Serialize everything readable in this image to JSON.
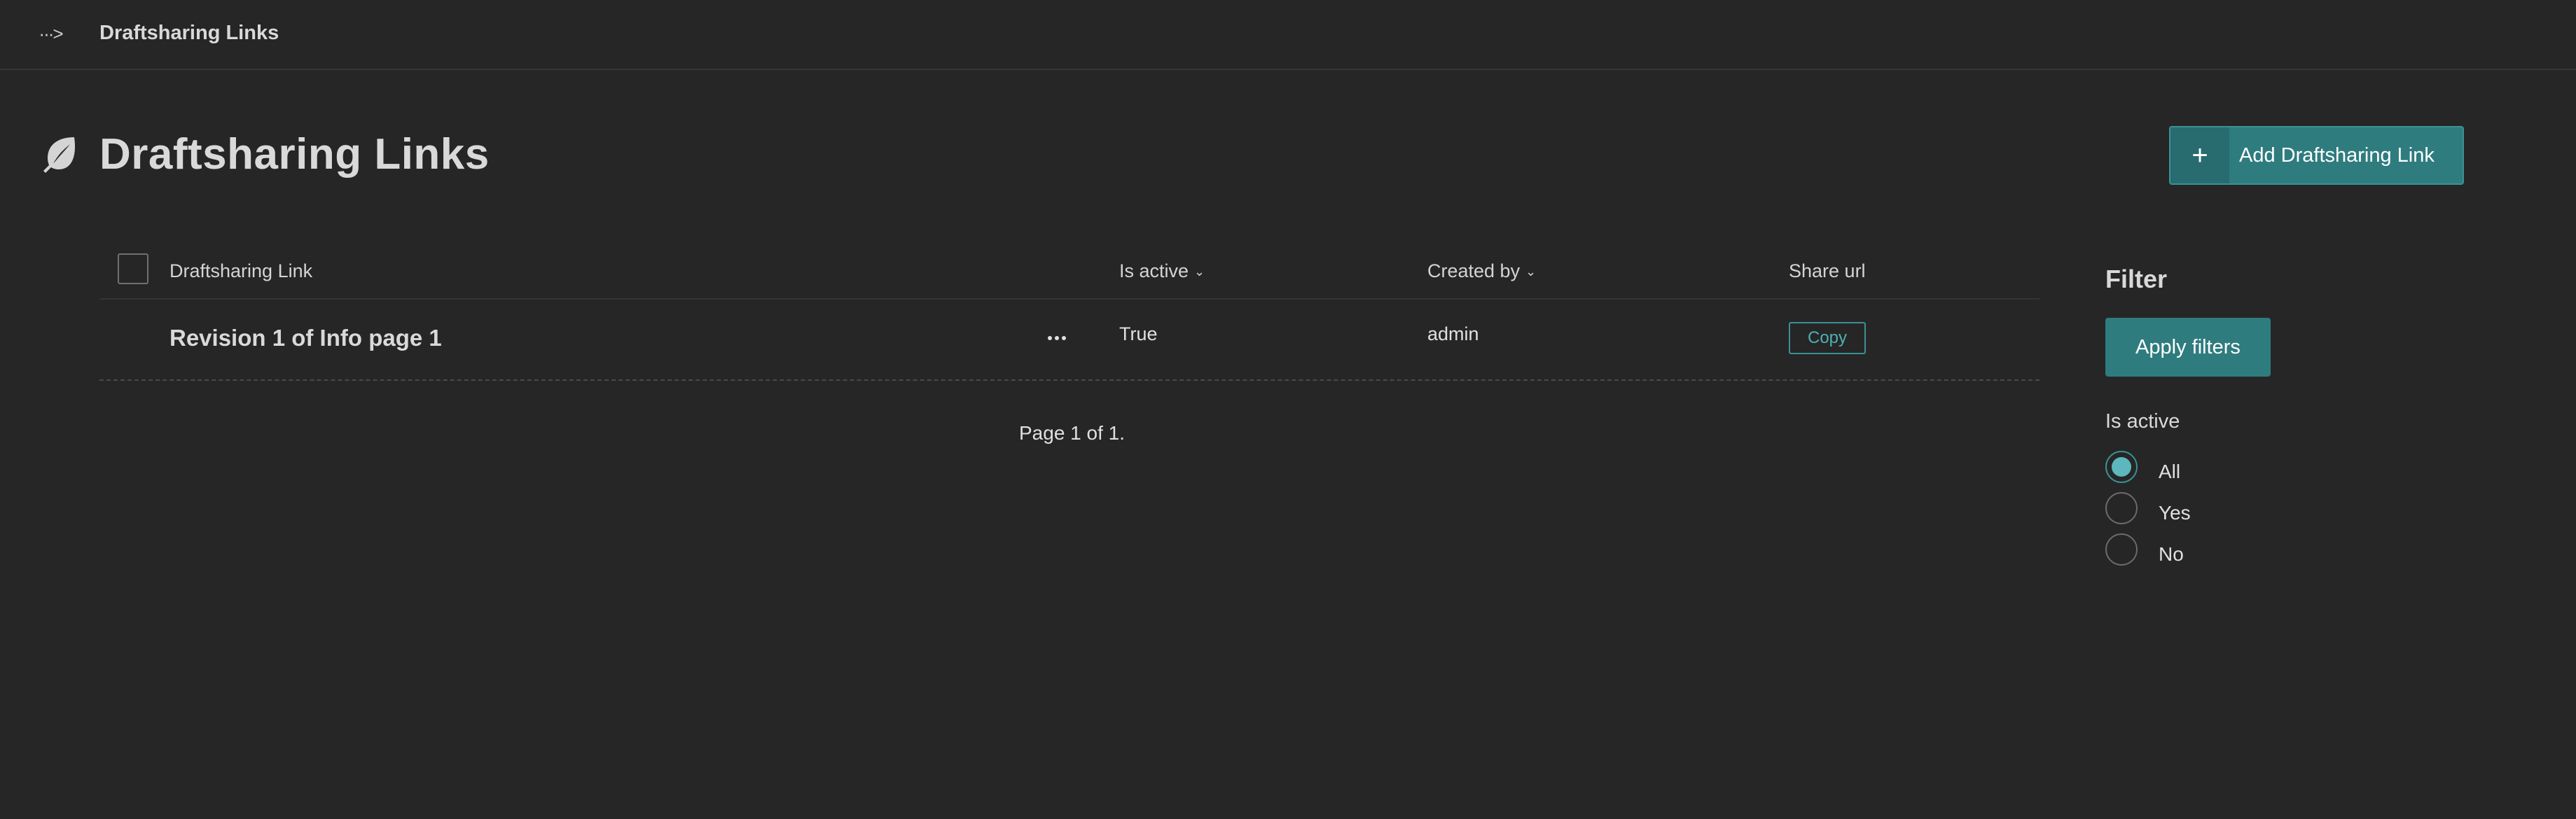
{
  "topbar": {
    "toggle_icon": "···>",
    "breadcrumb": "Draftsharing Links"
  },
  "header": {
    "icon": "leaf-icon",
    "title": "Draftsharing Links",
    "add_button_icon": "+",
    "add_button_label": "Add Draftsharing Link"
  },
  "table": {
    "columns": {
      "draftsharing_link": "Draftsharing Link",
      "is_active": "Is active",
      "created_by": "Created by",
      "share_url": "Share url"
    },
    "rows": [
      {
        "title": "Revision 1 of Info page 1",
        "is_active": "True",
        "created_by": "admin",
        "share_button": "Copy"
      }
    ],
    "pagination": "Page 1 of 1."
  },
  "filter": {
    "title": "Filter",
    "apply_label": "Apply filters",
    "is_active_label": "Is active",
    "options": [
      "All",
      "Yes",
      "No"
    ],
    "selected": "All"
  },
  "colors": {
    "background": "#262626",
    "accent": "#2f7c7f",
    "accent_light": "#5cb8bc"
  }
}
